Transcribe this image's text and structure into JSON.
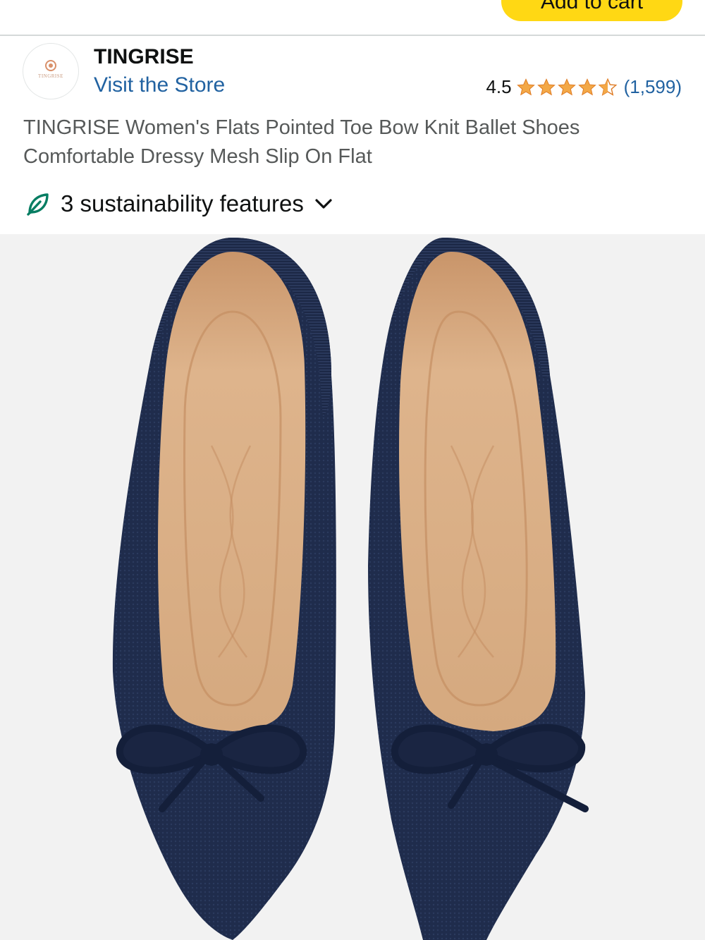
{
  "header": {
    "add_to_cart_label": "Add to cart"
  },
  "brand": {
    "logo_text": "TINGRISE",
    "name": "TINGRISE",
    "visit_store": "Visit the Store"
  },
  "rating": {
    "value": "4.5",
    "stars": 4.5,
    "count": "(1,599)",
    "star_color": "#f3a847"
  },
  "product": {
    "title": "TINGRISE Women's Flats Pointed Toe Bow Knit Ballet Shoes Comfortable Dressy Mesh Slip On Flat"
  },
  "sustainability": {
    "label": "3 sustainability features",
    "icon": "leaf-icon",
    "expand_icon": "chevron-down-icon",
    "color": "#067d62"
  },
  "image": {
    "alt_subject": "navy knit pointed-toe ballet flats with bow",
    "shoe_color": "#1e2b4a",
    "insole_color": "#d8ad85",
    "background": "#f2f2f2"
  },
  "colors": {
    "link": "#2162a1",
    "button": "#ffd814",
    "text": "#0f1111",
    "muted": "#565959"
  }
}
